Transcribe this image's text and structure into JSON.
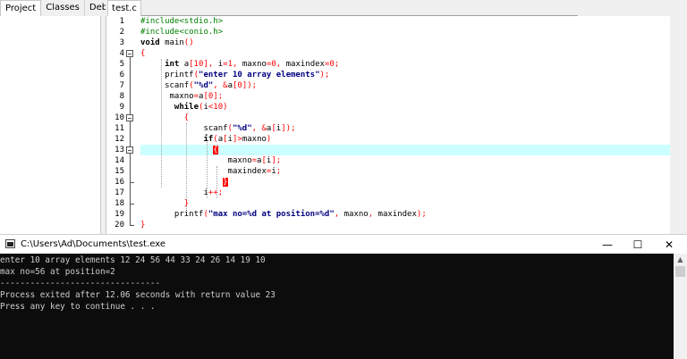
{
  "ide": {
    "left_tabs": [
      "Project",
      "Classes",
      "Debug"
    ],
    "editor_tab": "test.c"
  },
  "code_lines": [
    {
      "num": "1",
      "tokens": [
        {
          "t": "#include<stdio.h>",
          "c": "pp"
        }
      ]
    },
    {
      "num": "2",
      "tokens": [
        {
          "t": "#include<conio.h>",
          "c": "pp"
        }
      ]
    },
    {
      "num": "3",
      "tokens": [
        {
          "t": "void",
          "c": "kw"
        },
        {
          "t": " main",
          "c": "id"
        },
        {
          "t": "()",
          "c": "sym"
        }
      ]
    },
    {
      "num": "4",
      "tokens": [
        {
          "t": "{",
          "c": "sym"
        }
      ]
    },
    {
      "num": "5",
      "tokens": [
        {
          "t": "     int",
          "c": "kw"
        },
        {
          "t": " a",
          "c": "id"
        },
        {
          "t": "[",
          "c": "sym"
        },
        {
          "t": "10",
          "c": "num"
        },
        {
          "t": "], ",
          "c": "sym"
        },
        {
          "t": "i",
          "c": "id"
        },
        {
          "t": "=",
          "c": "sym"
        },
        {
          "t": "1",
          "c": "num"
        },
        {
          "t": ", ",
          "c": "sym"
        },
        {
          "t": "maxno",
          "c": "id"
        },
        {
          "t": "=",
          "c": "sym"
        },
        {
          "t": "0",
          "c": "num"
        },
        {
          "t": ", ",
          "c": "sym"
        },
        {
          "t": "maxindex",
          "c": "id"
        },
        {
          "t": "=",
          "c": "sym"
        },
        {
          "t": "0",
          "c": "num"
        },
        {
          "t": ";",
          "c": "sym"
        }
      ]
    },
    {
      "num": "6",
      "tokens": [
        {
          "t": "     printf",
          "c": "id"
        },
        {
          "t": "(",
          "c": "sym"
        },
        {
          "t": "\"enter 10 array elements\"",
          "c": "str"
        },
        {
          "t": ");",
          "c": "sym"
        }
      ]
    },
    {
      "num": "7",
      "tokens": [
        {
          "t": "     scanf",
          "c": "id"
        },
        {
          "t": "(",
          "c": "sym"
        },
        {
          "t": "\"%d\"",
          "c": "str"
        },
        {
          "t": ", &",
          "c": "sym"
        },
        {
          "t": "a",
          "c": "id"
        },
        {
          "t": "[",
          "c": "sym"
        },
        {
          "t": "0",
          "c": "num"
        },
        {
          "t": "]);",
          "c": "sym"
        }
      ]
    },
    {
      "num": "8",
      "tokens": [
        {
          "t": "      maxno",
          "c": "id"
        },
        {
          "t": "=",
          "c": "sym"
        },
        {
          "t": "a",
          "c": "id"
        },
        {
          "t": "[",
          "c": "sym"
        },
        {
          "t": "0",
          "c": "num"
        },
        {
          "t": "];",
          "c": "sym"
        }
      ]
    },
    {
      "num": "9",
      "tokens": [
        {
          "t": "       while",
          "c": "kw"
        },
        {
          "t": "(",
          "c": "sym"
        },
        {
          "t": "i",
          "c": "id"
        },
        {
          "t": "<",
          "c": "sym"
        },
        {
          "t": "10",
          "c": "num"
        },
        {
          "t": ")",
          "c": "sym"
        }
      ]
    },
    {
      "num": "10",
      "tokens": [
        {
          "t": "         {",
          "c": "sym"
        }
      ]
    },
    {
      "num": "11",
      "tokens": [
        {
          "t": "             scanf",
          "c": "id"
        },
        {
          "t": "(",
          "c": "sym"
        },
        {
          "t": "\"%d\"",
          "c": "str"
        },
        {
          "t": ", &",
          "c": "sym"
        },
        {
          "t": "a",
          "c": "id"
        },
        {
          "t": "[",
          "c": "sym"
        },
        {
          "t": "i",
          "c": "id"
        },
        {
          "t": "]);",
          "c": "sym"
        }
      ]
    },
    {
      "num": "12",
      "tokens": [
        {
          "t": "             if",
          "c": "kw"
        },
        {
          "t": "(",
          "c": "sym"
        },
        {
          "t": "a",
          "c": "id"
        },
        {
          "t": "[",
          "c": "sym"
        },
        {
          "t": "i",
          "c": "id"
        },
        {
          "t": "]>",
          "c": "sym"
        },
        {
          "t": "maxno",
          "c": "id"
        },
        {
          "t": ")",
          "c": "sym"
        }
      ]
    },
    {
      "num": "13",
      "tokens": [
        {
          "t": "               ",
          "c": "id"
        },
        {
          "t": "{",
          "c": "brk"
        }
      ]
    },
    {
      "num": "14",
      "tokens": [
        {
          "t": "                  maxno",
          "c": "id"
        },
        {
          "t": "=",
          "c": "sym"
        },
        {
          "t": "a",
          "c": "id"
        },
        {
          "t": "[",
          "c": "sym"
        },
        {
          "t": "i",
          "c": "id"
        },
        {
          "t": "];",
          "c": "sym"
        }
      ]
    },
    {
      "num": "15",
      "tokens": [
        {
          "t": "                  maxindex",
          "c": "id"
        },
        {
          "t": "=",
          "c": "sym"
        },
        {
          "t": "i",
          "c": "id"
        },
        {
          "t": ";",
          "c": "sym"
        }
      ]
    },
    {
      "num": "16",
      "tokens": [
        {
          "t": "                 ",
          "c": "id"
        },
        {
          "t": "}",
          "c": "brk"
        }
      ]
    },
    {
      "num": "17",
      "tokens": [
        {
          "t": "             i",
          "c": "id"
        },
        {
          "t": "++;",
          "c": "sym"
        }
      ]
    },
    {
      "num": "18",
      "tokens": [
        {
          "t": "         }",
          "c": "sym"
        }
      ]
    },
    {
      "num": "19",
      "tokens": [
        {
          "t": "       printf",
          "c": "id"
        },
        {
          "t": "(",
          "c": "sym"
        },
        {
          "t": "\"max no=%d at position=%d\"",
          "c": "str"
        },
        {
          "t": ", ",
          "c": "sym"
        },
        {
          "t": "maxno",
          "c": "id"
        },
        {
          "t": ", ",
          "c": "sym"
        },
        {
          "t": "maxindex",
          "c": "id"
        },
        {
          "t": ");",
          "c": "sym"
        }
      ]
    },
    {
      "num": "20",
      "tokens": [
        {
          "t": "}",
          "c": "sym"
        }
      ]
    }
  ],
  "console": {
    "title": "C:\\Users\\Ad\\Documents\\test.exe",
    "minimize": "—",
    "maximize": "☐",
    "close": "✕",
    "lines": [
      "enter 10 array elements 12 24 56 44 33 24 26 14 19 10",
      "max no=56 at position=2",
      "--------------------------------",
      "Process exited after 12.06 seconds with return value 23",
      "Press any key to continue . . ."
    ]
  }
}
